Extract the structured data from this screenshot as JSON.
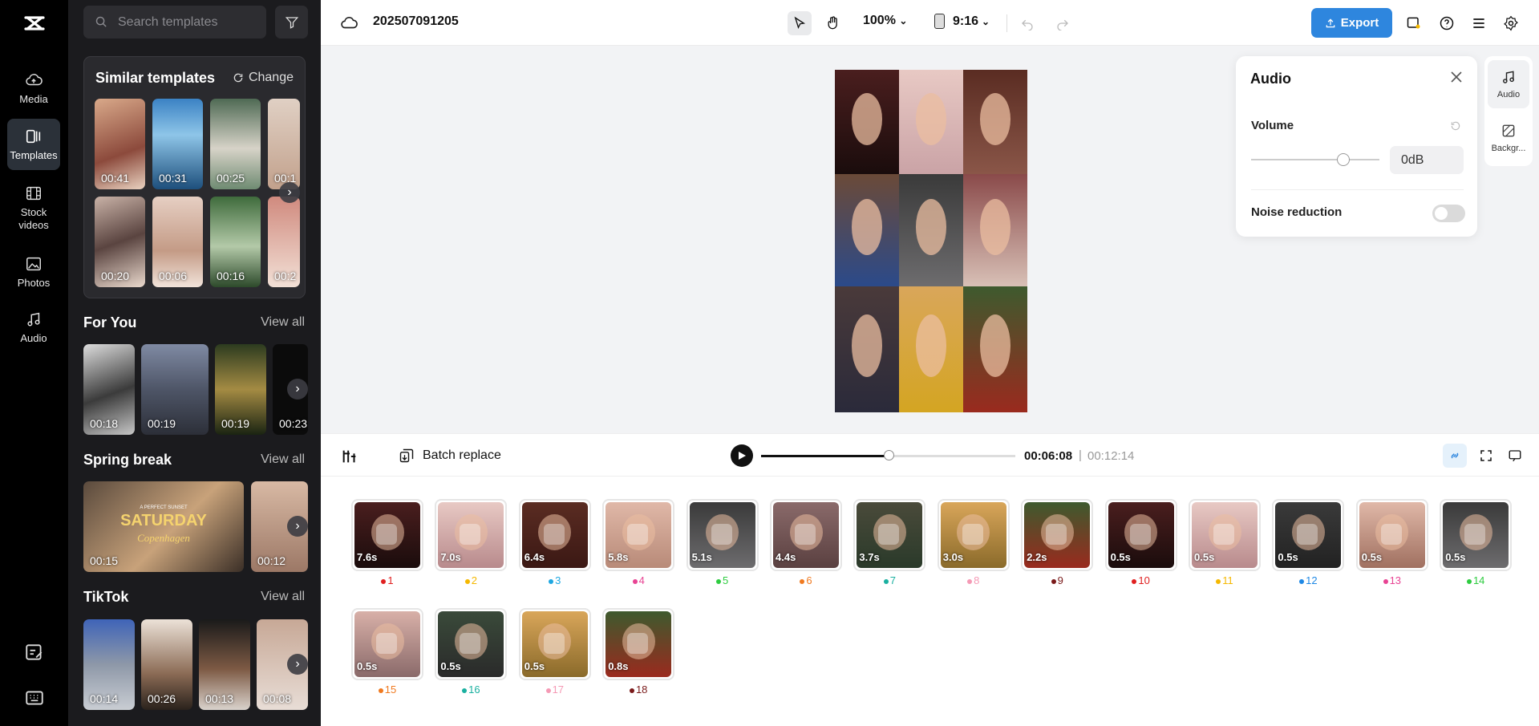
{
  "sidebar": {
    "items": [
      {
        "label": "Media",
        "icon": "cloud-upload-icon"
      },
      {
        "label": "Templates",
        "icon": "templates-icon"
      },
      {
        "label": "Stock videos",
        "icon": "film-icon"
      },
      {
        "label": "Photos",
        "icon": "image-icon"
      },
      {
        "label": "Audio",
        "icon": "music-note-icon"
      }
    ]
  },
  "panel": {
    "search_placeholder": "Search templates",
    "similar": {
      "title": "Similar templates",
      "change_label": "Change",
      "durations": [
        "00:41",
        "00:31",
        "00:25",
        "00:1",
        "00:20",
        "00:06",
        "00:16",
        "00:2"
      ]
    },
    "sections": [
      {
        "title": "For You",
        "view_all": "View all",
        "durations": [
          "00:18",
          "00:19",
          "00:19",
          "00:23"
        ]
      },
      {
        "title": "Spring break",
        "view_all": "View all",
        "durations": [
          "00:15",
          "00:12"
        ],
        "card_text": [
          "A PERFECT SUNSET",
          "SATURDAY",
          "Copenhagen"
        ]
      },
      {
        "title": "TikTok",
        "view_all": "View all",
        "durations": [
          "00:14",
          "00:26",
          "00:13",
          "00:08"
        ]
      }
    ]
  },
  "topbar": {
    "project_name": "202507091205",
    "zoom": "100%",
    "ratio": "9:16",
    "export_label": "Export"
  },
  "audio_panel": {
    "title": "Audio",
    "volume_label": "Volume",
    "volume_value": "0dB",
    "volume_level": 0.72,
    "noise_label": "Noise reduction",
    "noise_on": false
  },
  "side_tabs": [
    {
      "label": "Audio",
      "icon": "music-note-icon"
    },
    {
      "label": "Backgr...",
      "icon": "background-icon"
    }
  ],
  "playback": {
    "batch_label": "Batch replace",
    "current_time": "00:06:08",
    "separator": "|",
    "total_time": "00:12:14",
    "progress": 0.5
  },
  "clips": [
    {
      "dur": "7.6s",
      "num": "1",
      "dot": "#e02020"
    },
    {
      "dur": "7.0s",
      "num": "2",
      "dot": "#f5b800"
    },
    {
      "dur": "6.4s",
      "num": "3",
      "dot": "#1ea7e1"
    },
    {
      "dur": "5.8s",
      "num": "4",
      "dot": "#e84393"
    },
    {
      "dur": "5.1s",
      "num": "5",
      "dot": "#2ecc40"
    },
    {
      "dur": "4.4s",
      "num": "6",
      "dot": "#f07a20"
    },
    {
      "dur": "3.7s",
      "num": "7",
      "dot": "#1ab0a0"
    },
    {
      "dur": "3.0s",
      "num": "8",
      "dot": "#f59ab5"
    },
    {
      "dur": "2.2s",
      "num": "9",
      "dot": "#7a1a1a"
    },
    {
      "dur": "0.5s",
      "num": "10",
      "dot": "#e02020"
    },
    {
      "dur": "0.5s",
      "num": "11",
      "dot": "#f5b800"
    },
    {
      "dur": "0.5s",
      "num": "12",
      "dot": "#1e88e5"
    },
    {
      "dur": "0.5s",
      "num": "13",
      "dot": "#e84393"
    },
    {
      "dur": "0.5s",
      "num": "14",
      "dot": "#2ecc40"
    },
    {
      "dur": "0.5s",
      "num": "15",
      "dot": "#f07a20"
    },
    {
      "dur": "0.5s",
      "num": "16",
      "dot": "#1ab0a0"
    },
    {
      "dur": "0.5s",
      "num": "17",
      "dot": "#f59ab5"
    },
    {
      "dur": "0.8s",
      "num": "18",
      "dot": "#7a1a1a"
    }
  ],
  "colors": {
    "accent": "#2e86de",
    "rail_bg": "#000000",
    "panel_bg": "#1b1b1e"
  }
}
